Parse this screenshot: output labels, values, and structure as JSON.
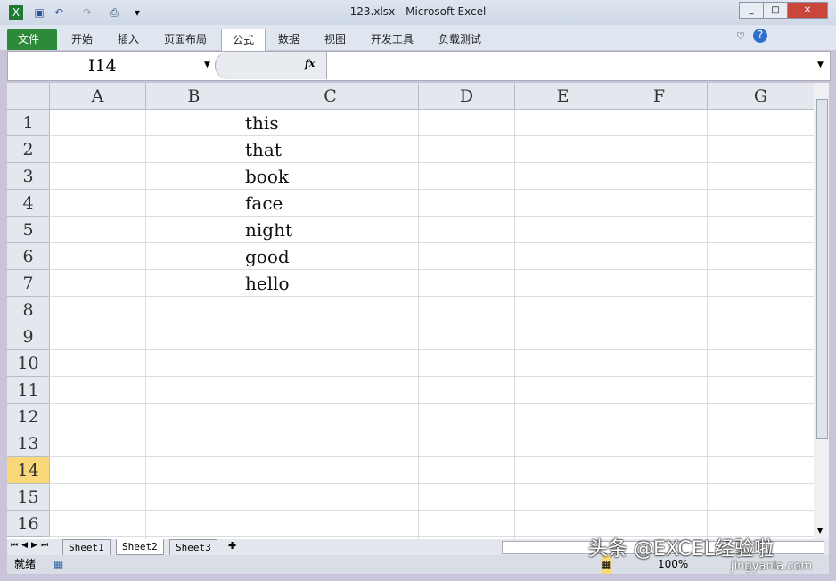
{
  "window": {
    "title": "123.xlsx - Microsoft Excel"
  },
  "ribbon": {
    "tabs": [
      "文件",
      "开始",
      "插入",
      "页面布局",
      "公式",
      "数据",
      "视图",
      "开发工具",
      "负载测试"
    ],
    "active": "公式"
  },
  "formula_bar": {
    "name_box": "I14",
    "fx": "fx",
    "value": ""
  },
  "columns": [
    "A",
    "B",
    "C",
    "D",
    "E",
    "F",
    "G"
  ],
  "rows": [
    "1",
    "2",
    "3",
    "4",
    "5",
    "6",
    "7",
    "8",
    "9",
    "10",
    "11",
    "12",
    "13",
    "14",
    "15",
    "16"
  ],
  "selected_row": "14",
  "cells_C": [
    "this",
    "that",
    "book",
    "face",
    "night",
    "good",
    "hello"
  ],
  "sheets": [
    "Sheet1",
    "Sheet2",
    "Sheet3"
  ],
  "active_sheet": "Sheet2",
  "status": {
    "ready": "就绪",
    "zoom": "100%"
  },
  "watermark": {
    "line1": "头条 @EXCEL经验啦",
    "line2": "jingyanla.com"
  }
}
